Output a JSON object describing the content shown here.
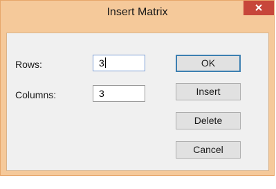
{
  "dialog": {
    "title": "Insert Matrix",
    "close_glyph": "×"
  },
  "form": {
    "rows_label": "Rows:",
    "rows_value": "3",
    "columns_label": "Columns:",
    "columns_value": "3"
  },
  "buttons": {
    "ok": "OK",
    "insert": "Insert",
    "delete": "Delete",
    "cancel": "Cancel"
  },
  "colors": {
    "frame": "#f5c99a",
    "close_button": "#c7463a",
    "client": "#f0f0f0",
    "input_border": "#7a9cd3"
  },
  "icons": {
    "close": "close-icon"
  }
}
